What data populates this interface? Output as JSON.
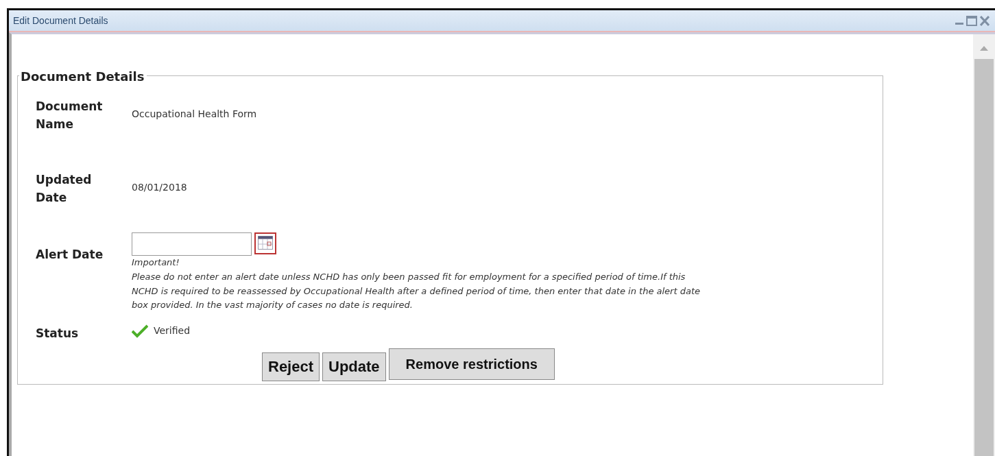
{
  "window": {
    "title": "Edit Document Details"
  },
  "fieldset": {
    "legend": "Document Details"
  },
  "fields": [
    {
      "kind": "text",
      "label": "Document Name",
      "value": "Occupational Health Form"
    },
    {
      "kind": "text",
      "label": "Updated Date",
      "value": "08/01/2018"
    },
    {
      "kind": "date",
      "label": "Alert Date",
      "note_title": "Important!",
      "note": "Please do not enter an alert date unless NCHD has only been passed fit for employment for a specified period of time.If this NCHD is required to be reassessed by Occupational Health after a defined period of time, then enter that date in the alert date box provided. In the vast majority of cases no date is required."
    },
    {
      "kind": "status",
      "label": "Status",
      "value": "Verified",
      "verified": true
    }
  ],
  "buttons": [
    {
      "label": "Reject",
      "kind": "small"
    },
    {
      "label": "Update",
      "kind": "small"
    },
    {
      "label": "Remove restrictions",
      "kind": "wide"
    }
  ]
}
